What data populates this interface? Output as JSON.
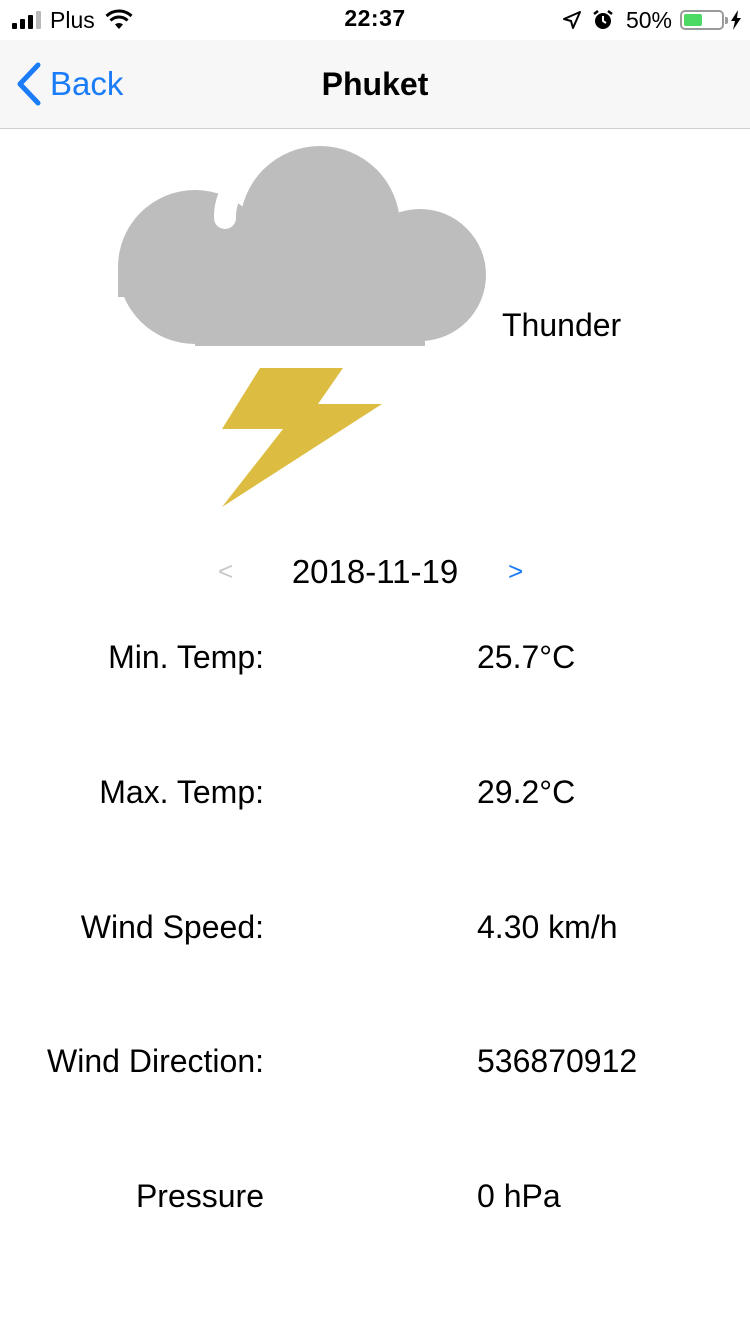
{
  "status_bar": {
    "carrier": "Plus",
    "time": "22:37",
    "battery_percent": "50%",
    "battery_level": 0.5,
    "icons": [
      "signal-icon",
      "wifi-icon",
      "location-arrow-icon",
      "alarm-icon",
      "battery-icon",
      "charging-bolt-icon"
    ]
  },
  "nav": {
    "back_label": "Back",
    "title": "Phuket",
    "tint_color": "#1a7cf6"
  },
  "weather": {
    "icon": "thunder-cloud-icon",
    "condition": "Thunder",
    "cloud_color": "#bdbdbd",
    "bolt_color": "#dcbd42"
  },
  "date_nav": {
    "prev": "<",
    "date": "2018-11-19",
    "next": ">"
  },
  "details": [
    {
      "label": "Min. Temp:",
      "value": "25.7°C"
    },
    {
      "label": "Max. Temp:",
      "value": "29.2°C"
    },
    {
      "label": "Wind Speed:",
      "value": "4.30 km/h"
    },
    {
      "label": "Wind Direction:",
      "value": "536870912"
    },
    {
      "label": "Pressure",
      "value": "0 hPa"
    }
  ]
}
